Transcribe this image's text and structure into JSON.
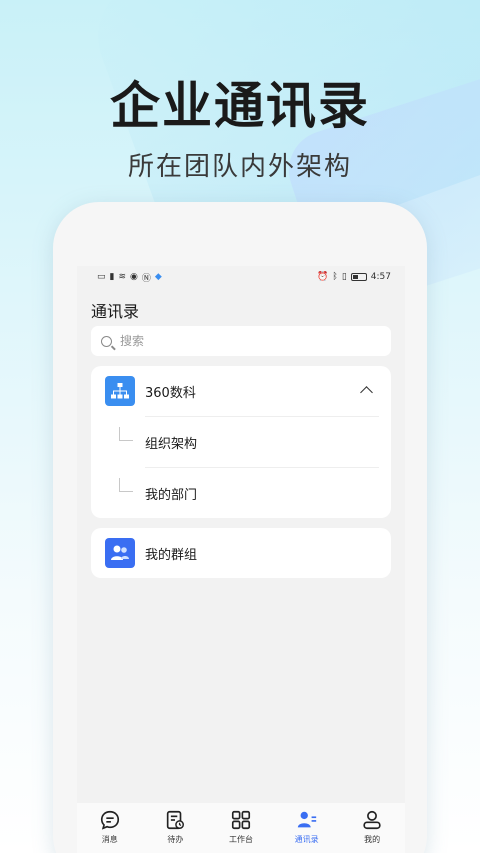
{
  "hero": {
    "title": "企业通讯录",
    "subtitle": "所在团队内外架构"
  },
  "statusbar": {
    "left_icons": [
      "hd-icon",
      "signal-icon",
      "wifi-icon",
      "eye-icon",
      "nfc-icon",
      "app-icon"
    ],
    "time": "4:57"
  },
  "page": {
    "title": "通讯录"
  },
  "search": {
    "placeholder": "搜索"
  },
  "org": {
    "name": "360数科",
    "icon": "org-chart-icon",
    "items": [
      {
        "label": "组织架构"
      },
      {
        "label": "我的部门"
      }
    ]
  },
  "groups": {
    "label": "我的群组",
    "icon": "group-icon"
  },
  "tabs": [
    {
      "label": "消息",
      "icon": "message-icon",
      "active": false
    },
    {
      "label": "待办",
      "icon": "todo-icon",
      "active": false
    },
    {
      "label": "工作台",
      "icon": "workbench-icon",
      "active": false
    },
    {
      "label": "通讯录",
      "icon": "contacts-icon",
      "active": true
    },
    {
      "label": "我的",
      "icon": "profile-icon",
      "active": false
    }
  ],
  "colors": {
    "accent": "#3a6ef2",
    "org_icon_bg": "#3a8ef0"
  }
}
